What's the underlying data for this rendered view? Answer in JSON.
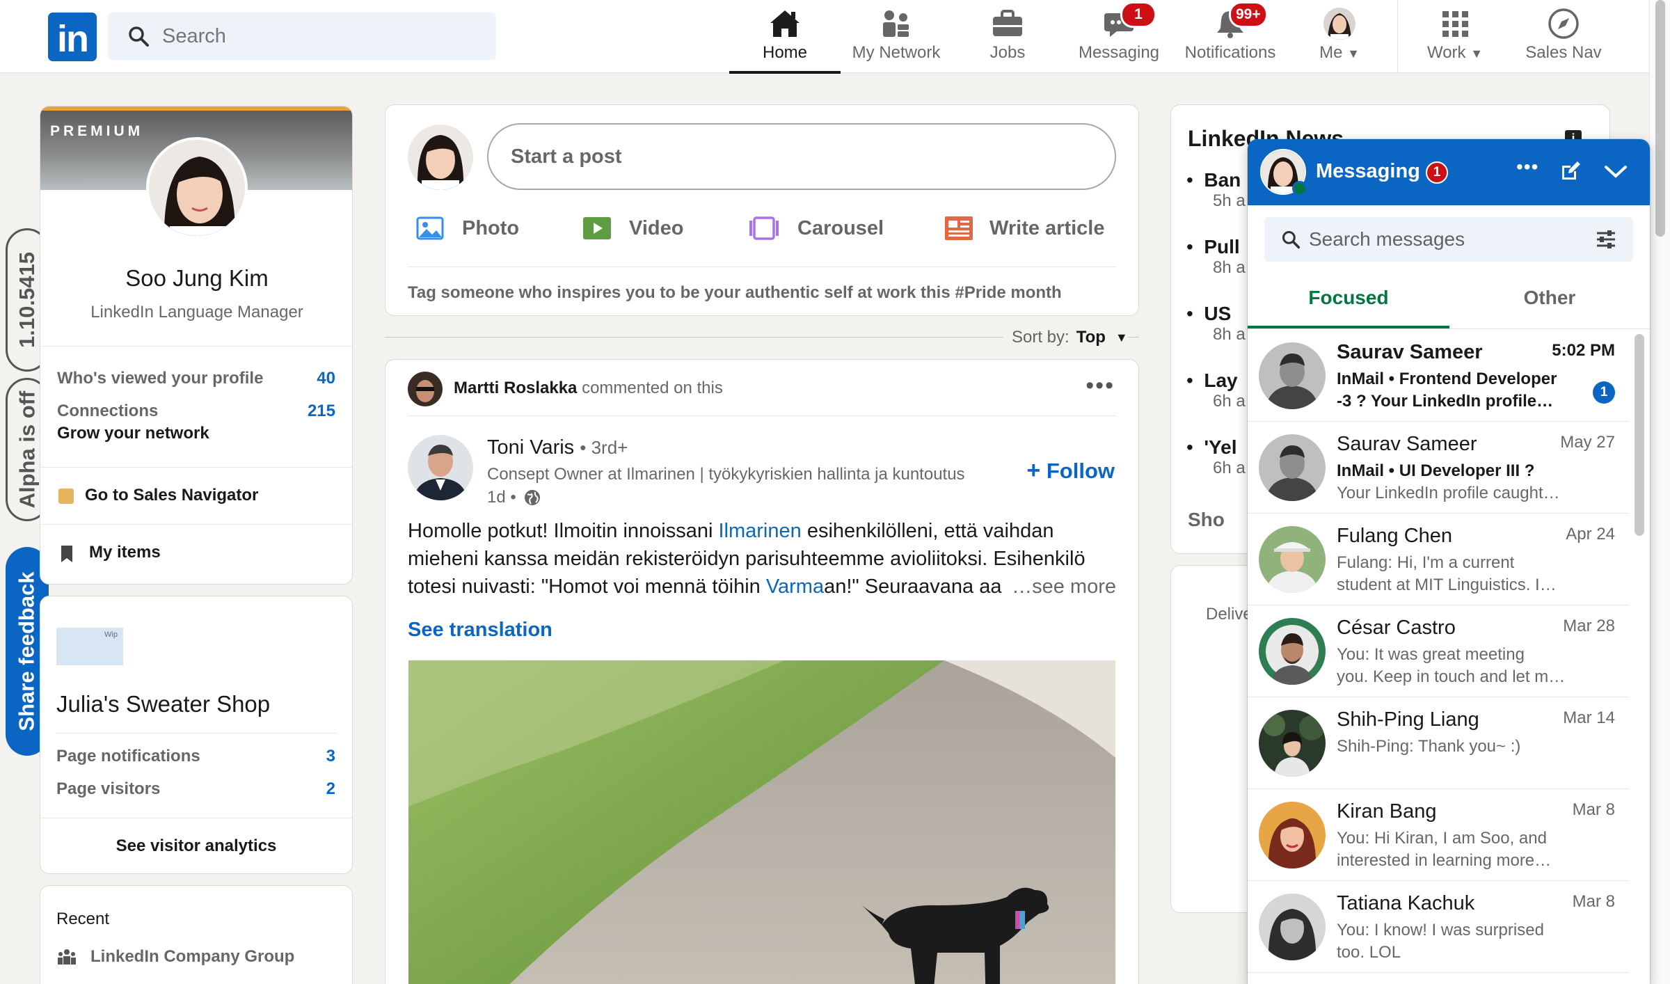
{
  "nav": {
    "search_placeholder": "Search",
    "items": [
      {
        "label": "Home",
        "icon": "home-icon"
      },
      {
        "label": "My Network",
        "icon": "people-icon"
      },
      {
        "label": "Jobs",
        "icon": "briefcase-icon"
      },
      {
        "label": "Messaging",
        "icon": "chat-icon",
        "badge": "1"
      },
      {
        "label": "Notifications",
        "icon": "bell-icon",
        "badge": "99+"
      },
      {
        "label": "Me",
        "icon": "avatar"
      },
      {
        "label": "Work",
        "icon": "grid-icon"
      },
      {
        "label": "Sales Nav",
        "icon": "compass-icon"
      }
    ]
  },
  "side_tabs": {
    "version": "1.10.5415",
    "alpha": "Alpha is off",
    "feedback": "Share feedback"
  },
  "profile": {
    "premium": "PREMIUM",
    "name": "Soo Jung Kim",
    "headline": "LinkedIn Language Manager",
    "viewed_label": "Who's viewed your profile",
    "viewed_count": "40",
    "connections_label": "Connections",
    "connections_count": "215",
    "grow_label": "Grow your network",
    "sales_nav": "Go to Sales Navigator",
    "my_items": "My items"
  },
  "page_card": {
    "page_name": "Julia's Sweater Shop",
    "notifications_label": "Page notifications",
    "notifications_count": "3",
    "visitors_label": "Page visitors",
    "visitors_count": "2",
    "analytics": "See visitor analytics"
  },
  "recent": {
    "title": "Recent",
    "item": "LinkedIn Company Group"
  },
  "share": {
    "placeholder": "Start a post",
    "photo": "Photo",
    "video": "Video",
    "carousel": "Carousel",
    "article": "Write article",
    "prompt": "Tag someone who inspires you to be your authentic self at work this #Pride month"
  },
  "sort": {
    "label": "Sort by:",
    "value": "Top"
  },
  "post": {
    "commenter": "Martti Roslakka",
    "commented": "commented on this",
    "author": "Toni Varis",
    "degree": "• 3rd+",
    "author_headline": "Consept Owner at Ilmarinen | työkykyriskien hallinta ja kuntoutus",
    "time": "1d •",
    "follow": "Follow",
    "text_1": "Homolle potkut! Ilmoitin innoissani ",
    "link_1": "Ilmarinen",
    "text_2": " esihenkilölleni, että vaihdan mieheni kanssa meidän rekisteröidyn parisuhteemme avioliitoksi. Esihenkilö totesi nuivasti: \"Homot voi mennä töihin ",
    "link_2": "Varma",
    "text_3": "an!\" Seuraavana aa",
    "see_more": "…see more",
    "see_translation": "See translation"
  },
  "news": {
    "title": "LinkedIn News",
    "items": [
      {
        "head": "Ban",
        "sub": "5h a"
      },
      {
        "head": "Pull",
        "sub": "8h a"
      },
      {
        "head": "US",
        "sub": "8h a"
      },
      {
        "head": "Lay",
        "sub": "6h a"
      },
      {
        "head": "'Yel",
        "sub": "6h a"
      }
    ],
    "show_more": "Sho",
    "ad_text": "Delive"
  },
  "messaging": {
    "title": "Messaging",
    "badge": "1",
    "search_placeholder": "Search messages",
    "tab_focused": "Focused",
    "tab_other": "Other",
    "conversations": [
      {
        "name": "Saurav Sameer",
        "date": "5:02 PM",
        "line1": "InMail •  Frontend Developer",
        "line2": "-3 ? Your LinkedIn profile…",
        "unread": "1"
      },
      {
        "name": "Saurav Sameer",
        "date": "May 27",
        "line1": "InMail •  UI Developer III ?",
        "line2": "Your LinkedIn profile caught…"
      },
      {
        "name": "Fulang Chen",
        "date": "Apr 24",
        "line1": "Fulang: Hi, I'm a current",
        "line2": "student at MIT Linguistics. I…"
      },
      {
        "name": "César Castro",
        "date": "Mar 28",
        "line1": "You: It was great meeting",
        "line2": "you. Keep in touch and let m…"
      },
      {
        "name": "Shih-Ping Liang",
        "date": "Mar 14",
        "line1": "Shih-Ping: Thank you~ :)",
        "line2": ""
      },
      {
        "name": "Kiran Bang",
        "date": "Mar 8",
        "line1": "You: Hi Kiran,  I am Soo, and",
        "line2": "interested in learning more…"
      },
      {
        "name": "Tatiana Kachuk",
        "date": "Mar 8",
        "line1": "You: I know! I was surprised",
        "line2": "too. LOL"
      }
    ]
  },
  "colors": {
    "brand": "#0a66c2",
    "badge": "#cc1016",
    "focused": "#057642",
    "background": "#f3f2ef"
  }
}
